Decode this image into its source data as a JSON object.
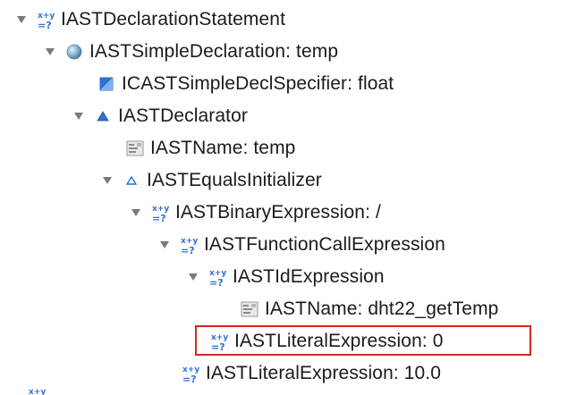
{
  "tree": {
    "nodes": [
      {
        "label": "IASTDeclarationStatement",
        "icon": "expression-icon",
        "expanded": true
      },
      {
        "label": "IASTSimpleDeclaration: temp",
        "icon": "sphere-icon",
        "expanded": true
      },
      {
        "label": "ICASTSimpleDeclSpecifier: float",
        "icon": "specifier-icon",
        "expanded": false
      },
      {
        "label": "IASTDeclarator",
        "icon": "triangle-filled-icon",
        "expanded": true
      },
      {
        "label": "IASTName: temp",
        "icon": "name-icon",
        "expanded": false
      },
      {
        "label": "IASTEqualsInitializer",
        "icon": "triangle-outline-icon",
        "expanded": true
      },
      {
        "label": "IASTBinaryExpression: /",
        "icon": "expression-icon",
        "expanded": true
      },
      {
        "label": "IASTFunctionCallExpression",
        "icon": "expression-icon",
        "expanded": true
      },
      {
        "label": "IASTIdExpression",
        "icon": "expression-icon",
        "expanded": true
      },
      {
        "label": "IASTName: dht22_getTemp",
        "icon": "name-icon",
        "expanded": false
      },
      {
        "label": "IASTLiteralExpression: 0",
        "icon": "expression-icon",
        "expanded": false,
        "highlighted": true
      },
      {
        "label": "IASTLiteralExpression: 10.0",
        "icon": "expression-icon",
        "expanded": false
      }
    ],
    "highlight_color": "#d7261e",
    "twisty_color": "#7a7a7a",
    "accent_blue": "#2f6fd6"
  }
}
